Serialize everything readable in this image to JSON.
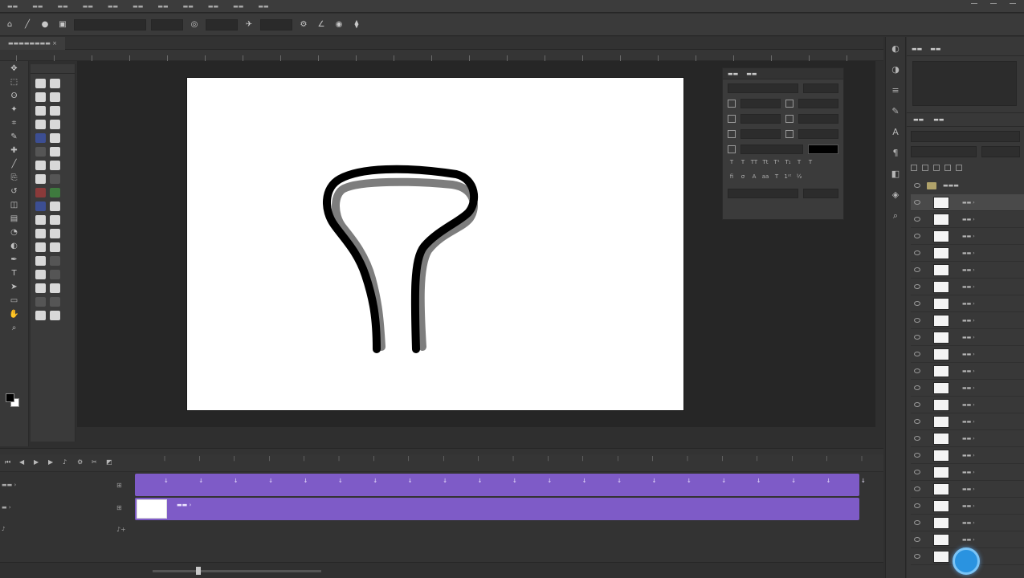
{
  "timeline": {
    "track1_keyframes": [
      "↓",
      "↓",
      "↓",
      "↓",
      "↓",
      "↓",
      "↓",
      "↓",
      "↓",
      "↓",
      "↓",
      "↓",
      "↓",
      "↓",
      "↓",
      "↓",
      "↓",
      "↓",
      "↓",
      "↓",
      "↓"
    ]
  },
  "character_panel": {
    "color": "#000000"
  },
  "layers": {
    "count": 22,
    "selected_index": 0
  },
  "colors": {
    "timeline_track": "#7e5bc7",
    "foreground": "#000000",
    "background": "#ffffff",
    "fab": "#2a93e0"
  },
  "icons": {
    "toolbar": [
      "move-icon",
      "marquee-icon",
      "lasso-icon",
      "quick-select-icon",
      "crop-icon",
      "eyedropper-icon",
      "healing-icon",
      "brush-icon",
      "clone-stamp-icon",
      "history-brush-icon",
      "eraser-icon",
      "gradient-icon",
      "blur-icon",
      "dodge-icon",
      "pen-icon",
      "type-icon",
      "path-select-icon",
      "shape-icon",
      "hand-icon",
      "zoom-icon"
    ],
    "right_strip": [
      "history-icon",
      "adjustments-icon",
      "properties-icon",
      "brush-settings-icon",
      "character-icon",
      "paragraph-icon",
      "layers-icon",
      "channels-icon",
      "paths-icon"
    ]
  }
}
